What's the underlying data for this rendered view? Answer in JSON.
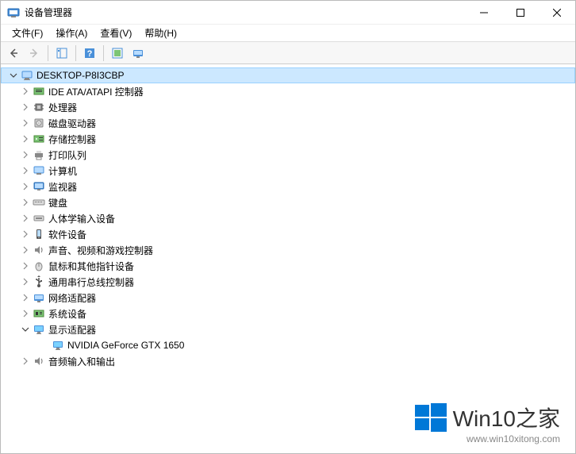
{
  "window": {
    "title": "设备管理器"
  },
  "menu": {
    "file": "文件(F)",
    "action": "操作(A)",
    "view": "查看(V)",
    "help": "帮助(H)"
  },
  "root": {
    "name": "DESKTOP-P8I3CBP"
  },
  "categories": [
    {
      "label": "IDE ATA/ATAPI 控制器",
      "icon": "ide"
    },
    {
      "label": "处理器",
      "icon": "cpu"
    },
    {
      "label": "磁盘驱动器",
      "icon": "disk"
    },
    {
      "label": "存储控制器",
      "icon": "storage"
    },
    {
      "label": "打印队列",
      "icon": "printer"
    },
    {
      "label": "计算机",
      "icon": "computer"
    },
    {
      "label": "监视器",
      "icon": "monitor"
    },
    {
      "label": "键盘",
      "icon": "keyboard"
    },
    {
      "label": "人体学输入设备",
      "icon": "hid"
    },
    {
      "label": "软件设备",
      "icon": "software"
    },
    {
      "label": "声音、视频和游戏控制器",
      "icon": "audio"
    },
    {
      "label": "鼠标和其他指针设备",
      "icon": "mouse"
    },
    {
      "label": "通用串行总线控制器",
      "icon": "usb"
    },
    {
      "label": "网络适配器",
      "icon": "network"
    },
    {
      "label": "系统设备",
      "icon": "system"
    },
    {
      "label": "显示适配器",
      "icon": "display",
      "expanded": true,
      "children": [
        {
          "label": "NVIDIA GeForce GTX 1650",
          "icon": "display"
        }
      ]
    },
    {
      "label": "音频输入和输出",
      "icon": "audio"
    }
  ],
  "watermark": {
    "title": "Win10之家",
    "url": "www.win10xitong.com"
  }
}
